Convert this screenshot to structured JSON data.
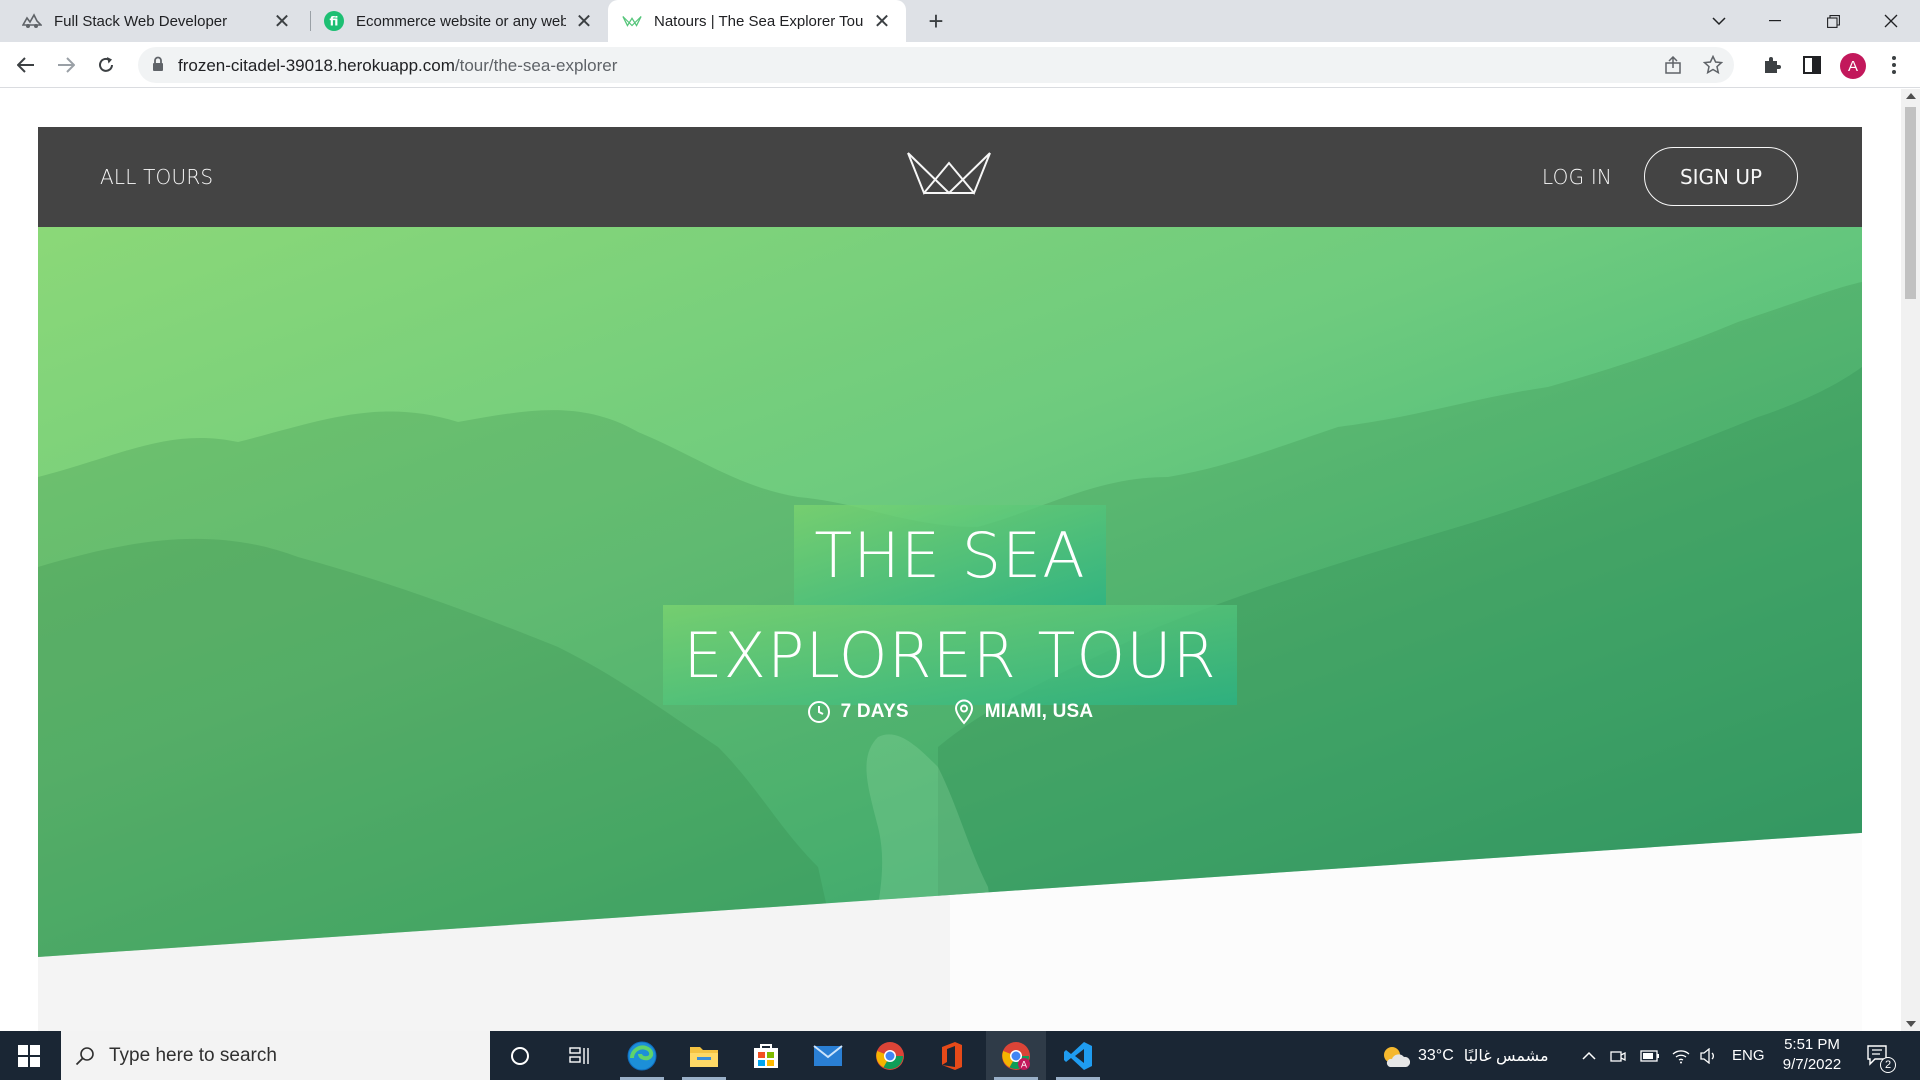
{
  "browser": {
    "tabs": [
      {
        "label": "Full Stack Web Developer",
        "icon": "freelancer-icon"
      },
      {
        "label": "Ecommerce website or any websi",
        "icon": "fiverr-icon"
      },
      {
        "label": "Natours | The Sea Explorer Tour",
        "icon": "natours-icon",
        "active": true
      }
    ],
    "url_host": "frozen-citadel-39018.herokuapp.com",
    "url_path": "/tour/the-sea-explorer",
    "avatar_letter": "A"
  },
  "site": {
    "nav": {
      "all_tours": "ALL TOURS",
      "log_in": "LOG IN",
      "sign_up": "SIGN UP"
    },
    "hero": {
      "title_line1": "THE SEA",
      "title_line2": "EXPLORER TOUR",
      "duration": "7 DAYS",
      "location": "MIAMI, USA"
    }
  },
  "taskbar": {
    "search_placeholder": "Type here to search",
    "weather_temp": "33°C",
    "weather_text": "مشمس غالبًا",
    "language": "ENG",
    "time": "5:51 PM",
    "date": "9/7/2022",
    "notification_count": "2"
  }
}
